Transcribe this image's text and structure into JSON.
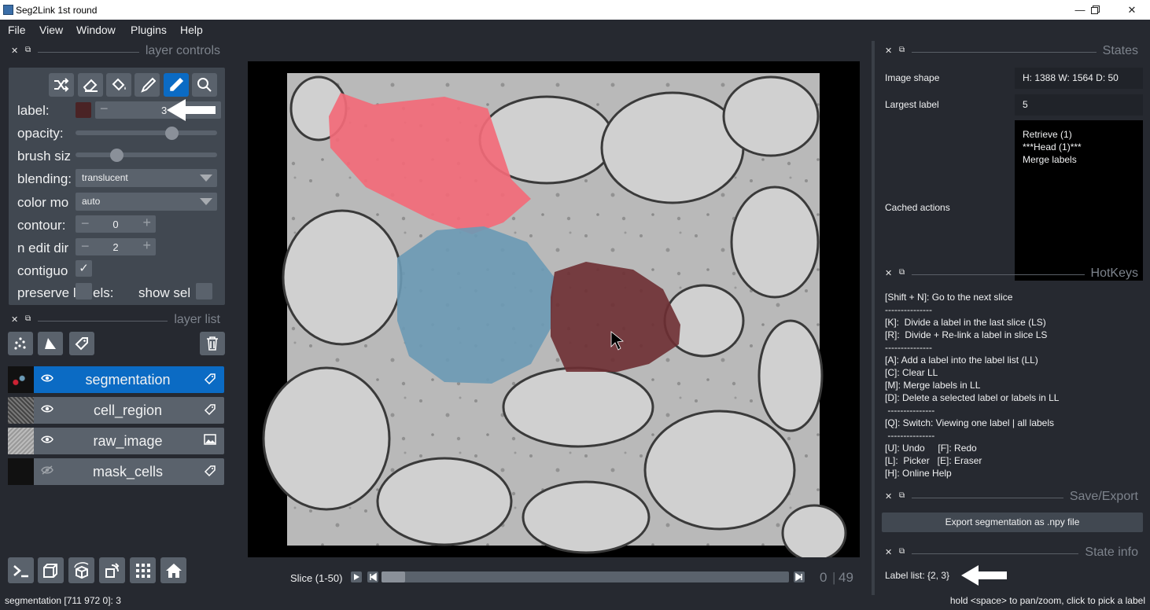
{
  "window": {
    "title": "Seg2Link 1st round",
    "minimize": "—",
    "maximize": "▢",
    "close": "✕"
  },
  "menu": [
    "File",
    "View",
    "Window",
    "Plugins",
    "Help"
  ],
  "layer_controls": {
    "header": "layer controls",
    "label_caption": "label:",
    "label_value": "3",
    "label_color": "#4a2325",
    "opacity_caption": "opacity:",
    "opacity": 0.7,
    "brush_caption": "brush siz",
    "brush_size": 0.27,
    "blending_caption": "blending:",
    "blending_value": "translucent",
    "colormode_caption": "color mo",
    "colormode_value": "auto",
    "contour_caption": "contour:",
    "contour_value": "0",
    "ndim_caption": "n edit dir",
    "ndim_value": "2",
    "contiguous_caption": "contiguo",
    "preserve_caption": "preserve l",
    "preserve_suffix": "els:",
    "show_sel_caption": "show sel"
  },
  "layer_list": {
    "header": "layer list",
    "layers": [
      {
        "name": "segmentation",
        "visible": true,
        "type_icon": "tag-icon",
        "selected": true
      },
      {
        "name": "cell_region",
        "visible": true,
        "type_icon": "tag-icon",
        "selected": false
      },
      {
        "name": "raw_image",
        "visible": true,
        "type_icon": "image-icon",
        "selected": false
      },
      {
        "name": "mask_cells",
        "visible": false,
        "type_icon": "tag-icon",
        "selected": false
      }
    ]
  },
  "viewer": {
    "slice_label": "Slice (1-50)",
    "current_slice": "0",
    "total_slices": "49",
    "slider_position": 0.0
  },
  "states": {
    "header": "States",
    "image_shape_caption": "Image shape",
    "image_shape_value": "H: 1388  W: 1564  D: 50",
    "largest_label_caption": "Largest label",
    "largest_label_value": "5",
    "cached_actions_caption": "Cached actions",
    "cached_actions": [
      "Retrieve (1)",
      "***Head (1)***",
      "Merge labels"
    ]
  },
  "hotkeys": {
    "header": "HotKeys",
    "lines": [
      "[Shift + N]: Go to the next slice",
      "---------------",
      "[K]:  Divide a label in the last slice (LS)",
      "[R]:  Divide + Re-link a label in slice LS",
      "---------------",
      "[A]: Add a label into the label list (LL)",
      "[C]: Clear LL",
      "[M]: Merge labels in LL",
      "[D]: Delete a selected label or labels in LL",
      " ---------------",
      "[Q]: Switch: Viewing one label | all labels",
      " ---------------",
      "[U]: Undo     [F]: Redo",
      "[L]:  Picker   [E]: Eraser",
      "[H]: Online Help"
    ]
  },
  "save_export": {
    "header": "Save/Export",
    "button": "Export segmentation as .npy file"
  },
  "state_info": {
    "header": "State info",
    "label_list": "Label list: {2, 3}"
  },
  "status": {
    "left": "segmentation [711 972   0]: 3",
    "right": "hold <space> to pan/zoom, click to pick a label"
  },
  "colors": {
    "background": "#262930",
    "panel": "#414851",
    "button": "#5a626c",
    "accent": "#0b6bc4",
    "label_red": "#f26a78",
    "label_blue": "#6b9ab5",
    "label_darkred": "#6e2f33"
  }
}
